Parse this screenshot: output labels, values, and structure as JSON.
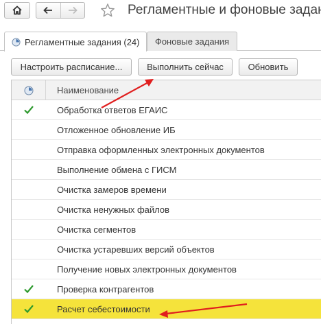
{
  "window": {
    "title": "Регламентные и фоновые задан",
    "icons": {
      "home": "home-icon",
      "back": "arrow-left-icon",
      "forward": "arrow-right-icon",
      "favorite": "star-outline-icon"
    }
  },
  "tabs": [
    {
      "label": "Регламентные задания (24)",
      "active": true,
      "icon": "clock-icon"
    },
    {
      "label": "Фоновые задания",
      "active": false
    }
  ],
  "toolbar": {
    "schedule_label": "Настроить расписание...",
    "run_label": "Выполнить сейчас",
    "refresh_label": "Обновить"
  },
  "table": {
    "header": {
      "status_icon": "clock-icon",
      "name": "Наименование"
    },
    "rows": [
      {
        "name": "Обработка ответов ЕГАИС",
        "status": "done"
      },
      {
        "name": "Отложенное обновление ИБ",
        "status": ""
      },
      {
        "name": "Отправка оформленных электронных документов",
        "status": ""
      },
      {
        "name": "Выполнение обмена с ГИСМ",
        "status": ""
      },
      {
        "name": "Очистка замеров времени",
        "status": ""
      },
      {
        "name": "Очистка ненужных файлов",
        "status": ""
      },
      {
        "name": "Очистка сегментов",
        "status": ""
      },
      {
        "name": "Очистка устаревших версий объектов",
        "status": ""
      },
      {
        "name": "Получение новых электронных документов",
        "status": ""
      },
      {
        "name": "Проверка контрагентов",
        "status": "done"
      },
      {
        "name": "Расчет себестоимости",
        "status": "done",
        "selected": true
      }
    ]
  },
  "colors": {
    "check": "#2e9a2e",
    "selected_row": "#f5e33b",
    "annotation_arrow": "#e01e1e"
  }
}
